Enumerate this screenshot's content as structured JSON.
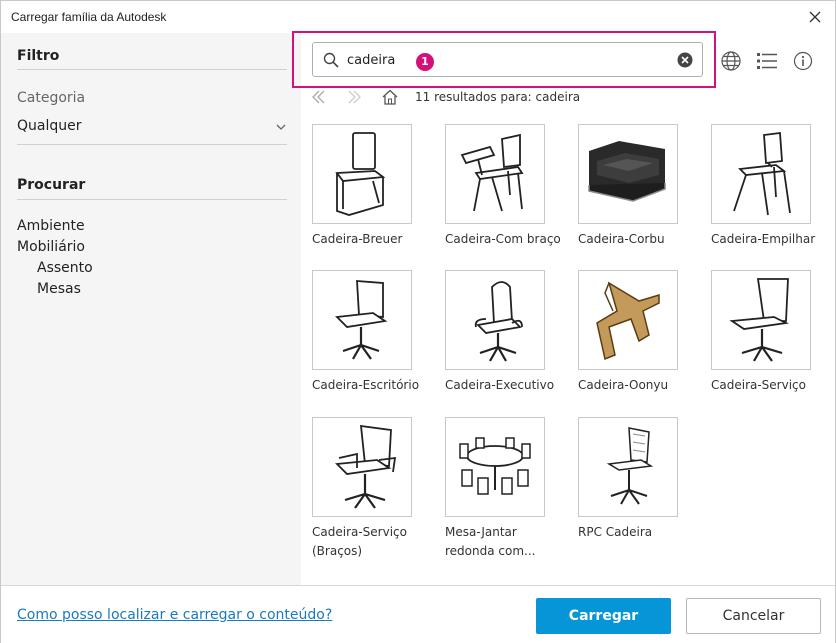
{
  "window": {
    "title": "Carregar família da Autodesk"
  },
  "filter": {
    "heading": "Filtro",
    "category_label": "Categoria",
    "category_value": "Qualquer"
  },
  "browse": {
    "heading": "Procurar",
    "items": [
      {
        "label": "Ambiente"
      },
      {
        "label": "Mobiliário"
      },
      {
        "label": "Assento"
      },
      {
        "label": "Mesas"
      }
    ]
  },
  "search": {
    "value": "cadeira",
    "badge": "1"
  },
  "results_text": "11 resultados para: cadeira",
  "items": [
    {
      "name": "Cadeira-Breuer"
    },
    {
      "name": "Cadeira-Com braço"
    },
    {
      "name": "Cadeira-Corbu"
    },
    {
      "name": "Cadeira-Empilhar"
    },
    {
      "name": "Cadeira-Escritório"
    },
    {
      "name": "Cadeira-Executivo"
    },
    {
      "name": "Cadeira-Oonyu"
    },
    {
      "name": "Cadeira-Serviço"
    },
    {
      "name": "Cadeira-Serviço (Braços)"
    },
    {
      "name": "Mesa-Jantar redonda com..."
    },
    {
      "name": "RPC Cadeira"
    }
  ],
  "footer": {
    "help_link": "Como posso localizar e carregar o conteúdo?",
    "load_button": "Carregar",
    "cancel_button": "Cancelar"
  },
  "colors": {
    "highlight": "#d4117a",
    "primary_button": "#0696d7",
    "link": "#1a7abf"
  }
}
